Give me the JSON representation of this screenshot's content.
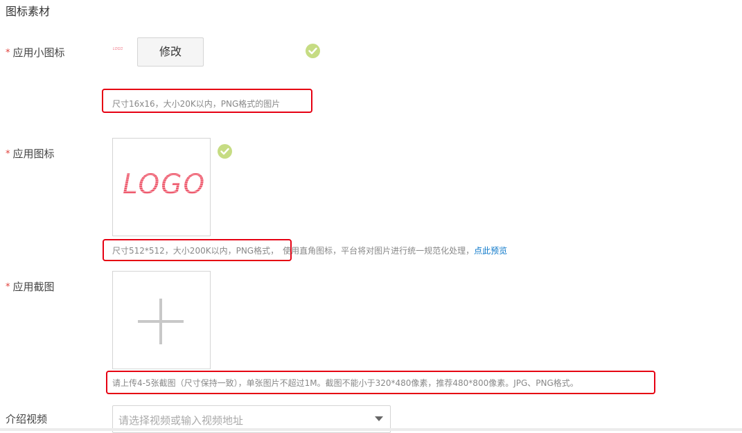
{
  "section": {
    "title": "图标素材"
  },
  "small_icon": {
    "label": "应用小图标",
    "required_mark": "*",
    "logo_text": "LOGO",
    "modify_button": "修改",
    "hint": "尺寸16x16，大小20K以内，PNG格式的图片"
  },
  "app_icon": {
    "label": "应用图标",
    "required_mark": "*",
    "logo_text": "LOGO",
    "hint_boxed": "尺寸512*512，大小200K以内，PNG格式，",
    "hint_rest": "使用直角图标，平台将对图片进行统一规范化处理，",
    "preview_link": "点此预览"
  },
  "screenshot": {
    "label": "应用截图",
    "required_mark": "*",
    "hint": "请上传4-5张截图（尺寸保持一致），单张图片不超过1M。截图不能小于320*480像素，推荐480*800像素。JPG、PNG格式。"
  },
  "video": {
    "label": "介绍视频",
    "placeholder": "请选择视频或输入视频地址"
  },
  "colors": {
    "required": "#e0403b",
    "highlight_border": "#e60012",
    "check": "#c6dc83",
    "link": "#0b77c9",
    "logo": "#ee5b6e"
  }
}
